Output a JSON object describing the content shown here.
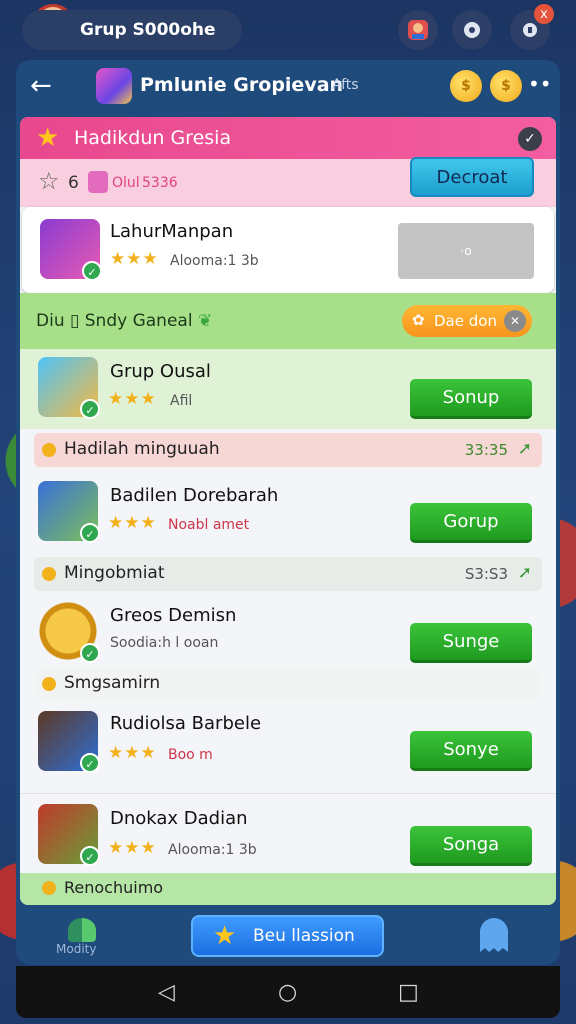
{
  "topbar": {
    "profile_name": "Grup S000ohe",
    "icons": [
      "game-icon",
      "controller-icon",
      "notification-icon"
    ],
    "badge": "x"
  },
  "header": {
    "title": "Pmlunie Gropievan",
    "subtitle": "Afts",
    "back_icon": "arrow-left"
  },
  "section": {
    "title": "Hadikdun Gresia",
    "stat_count": "6",
    "stat_a": "Olul",
    "stat_b": "5336",
    "detail_button": "Decroat"
  },
  "featured": {
    "title": "LahurManpan",
    "stars": "★★★",
    "meta": "Alooma:1 3b",
    "placeholder": "·o"
  },
  "group_band": {
    "label": "Diu",
    "label_rest": "Sndy Ganeal",
    "tag": "Dae don"
  },
  "items": [
    {
      "title": "Grup Ousal",
      "stars": "★★★",
      "meta": "Afil",
      "button": "Sonup"
    },
    {
      "title": "Badilen Dorebarah",
      "stars": "★★★",
      "meta": "Noabl amet",
      "button": "Gorup"
    },
    {
      "title": "Greos Demisn",
      "stars": "",
      "meta": "Soodia:h l ooan",
      "button": "Sunge"
    },
    {
      "title": "Rudiolsa Barbele",
      "stars": "★★★",
      "meta": "Boo m",
      "button": "Sonye"
    },
    {
      "title": "Dnokax Dadian",
      "stars": "★★★",
      "meta": "Alooma:1 3b",
      "button": "Songa"
    }
  ],
  "sub_rows": [
    {
      "text": "Hadilah minguuah",
      "value": "33:35"
    },
    {
      "text": "Mingobmiat",
      "value": "S3:S3"
    },
    {
      "text": "Smgsamirn",
      "value": ""
    }
  ],
  "bottom_band": {
    "text": "Renochuimo"
  },
  "nav": {
    "left_label": "Modity",
    "cta": "Beu llassion"
  }
}
